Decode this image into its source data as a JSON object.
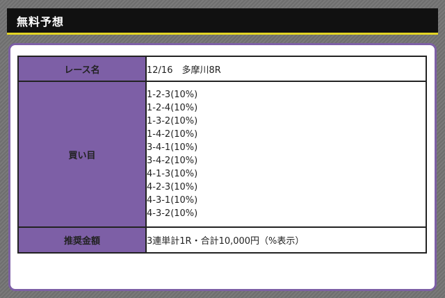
{
  "header": {
    "title": "無料予想"
  },
  "table": {
    "race": {
      "label": "レース名",
      "value": "12/16　多摩川8R"
    },
    "bets": {
      "label": "買い目",
      "items": [
        "1-2-3(10%)",
        "1-2-4(10%)",
        "1-3-2(10%)",
        "1-4-2(10%)",
        "3-4-1(10%)",
        "3-4-2(10%)",
        "4-1-3(10%)",
        "4-2-3(10%)",
        "4-3-1(10%)",
        "4-3-2(10%)"
      ]
    },
    "amount": {
      "label": "推奨金額",
      "value": "3連単計1R・合計10,000円（%表示）"
    }
  },
  "colors": {
    "accent": "#7d5fa6",
    "header_bg": "#111111",
    "header_underline": "#e2d424"
  }
}
